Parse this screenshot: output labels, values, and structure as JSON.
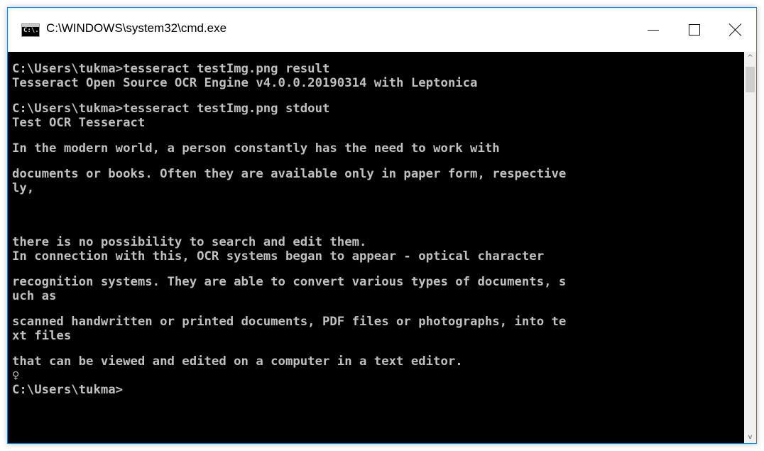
{
  "window": {
    "title": "C:\\WINDOWS\\system32\\cmd.exe",
    "icon": "cmd-icon",
    "icon_text": "C:\\."
  },
  "controls": {
    "minimize_icon": "minimize-icon",
    "maximize_icon": "maximize-icon",
    "close_icon": "close-icon"
  },
  "console": {
    "lines": [
      "C:\\Users\\tukma>tesseract testImg.png result",
      "Tesseract Open Source OCR Engine v4.0.0.20190314 with Leptonica",
      "C:\\Users\\tukma>tesseract testImg.png stdout",
      "Test OCR Tesseract",
      "In the modern world, a person constantly has the need to work with",
      "documents or books. Often they are available only in paper form, respective",
      "ly,",
      "there is no possibility to search and edit them.",
      "In connection with this, OCR systems began to appear - optical character",
      "recognition systems. They are able to convert various types of documents, s",
      "uch as",
      "scanned handwritten or printed documents, PDF files or photographs, into te",
      "xt files",
      "that can be viewed and edited on a computer in a text editor.",
      "♀",
      "C:\\Users\\tukma>"
    ]
  },
  "colors": {
    "console_bg": "#000000",
    "console_fg": "#c0c0c0",
    "titlebar_bg": "#ffffff",
    "window_border": "#1883d7"
  },
  "scrollbar": {
    "up_arrow": "^",
    "down_arrow": "v"
  }
}
